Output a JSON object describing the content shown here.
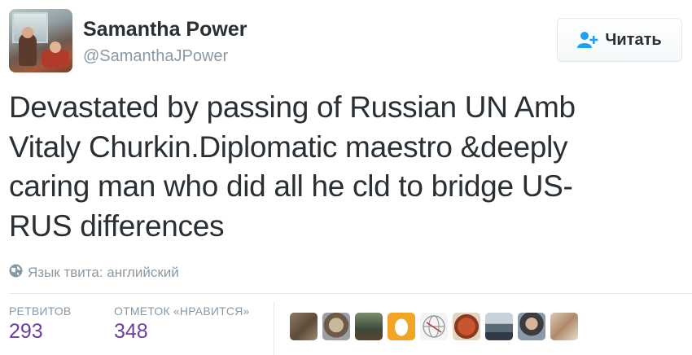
{
  "author": {
    "name": "Samantha Power",
    "handle": "@SamanthaJPower",
    "avatar_icon": "profile-photo"
  },
  "follow_button": {
    "label": "Читать",
    "icon": "follow-user-icon",
    "accent": "#1da1f2"
  },
  "tweet": {
    "lines": [
      "Devastated by passing of Russian UN Amb",
      "Vitaly Churkin.Diplomatic maestro &deeply",
      "caring man who did all he cld to bridge US-",
      "RUS differences"
    ]
  },
  "language_note": {
    "icon": "globe-icon",
    "text": "Язык твита: английский"
  },
  "stats": {
    "retweets": {
      "label": "РЕТВИТОВ",
      "value": "293"
    },
    "likes": {
      "label": "ОТМЕТОК «НРАВИТСЯ»",
      "value": "348"
    },
    "value_color": "#6b3fa0"
  },
  "likers": [
    {
      "icon": "liker-avatar-1"
    },
    {
      "icon": "liker-avatar-2"
    },
    {
      "icon": "liker-avatar-3"
    },
    {
      "icon": "liker-avatar-4-egg"
    },
    {
      "icon": "liker-avatar-5-globe"
    },
    {
      "icon": "liker-avatar-6-emblem"
    },
    {
      "icon": "liker-avatar-7"
    },
    {
      "icon": "liker-avatar-8"
    },
    {
      "icon": "liker-avatar-9"
    }
  ]
}
